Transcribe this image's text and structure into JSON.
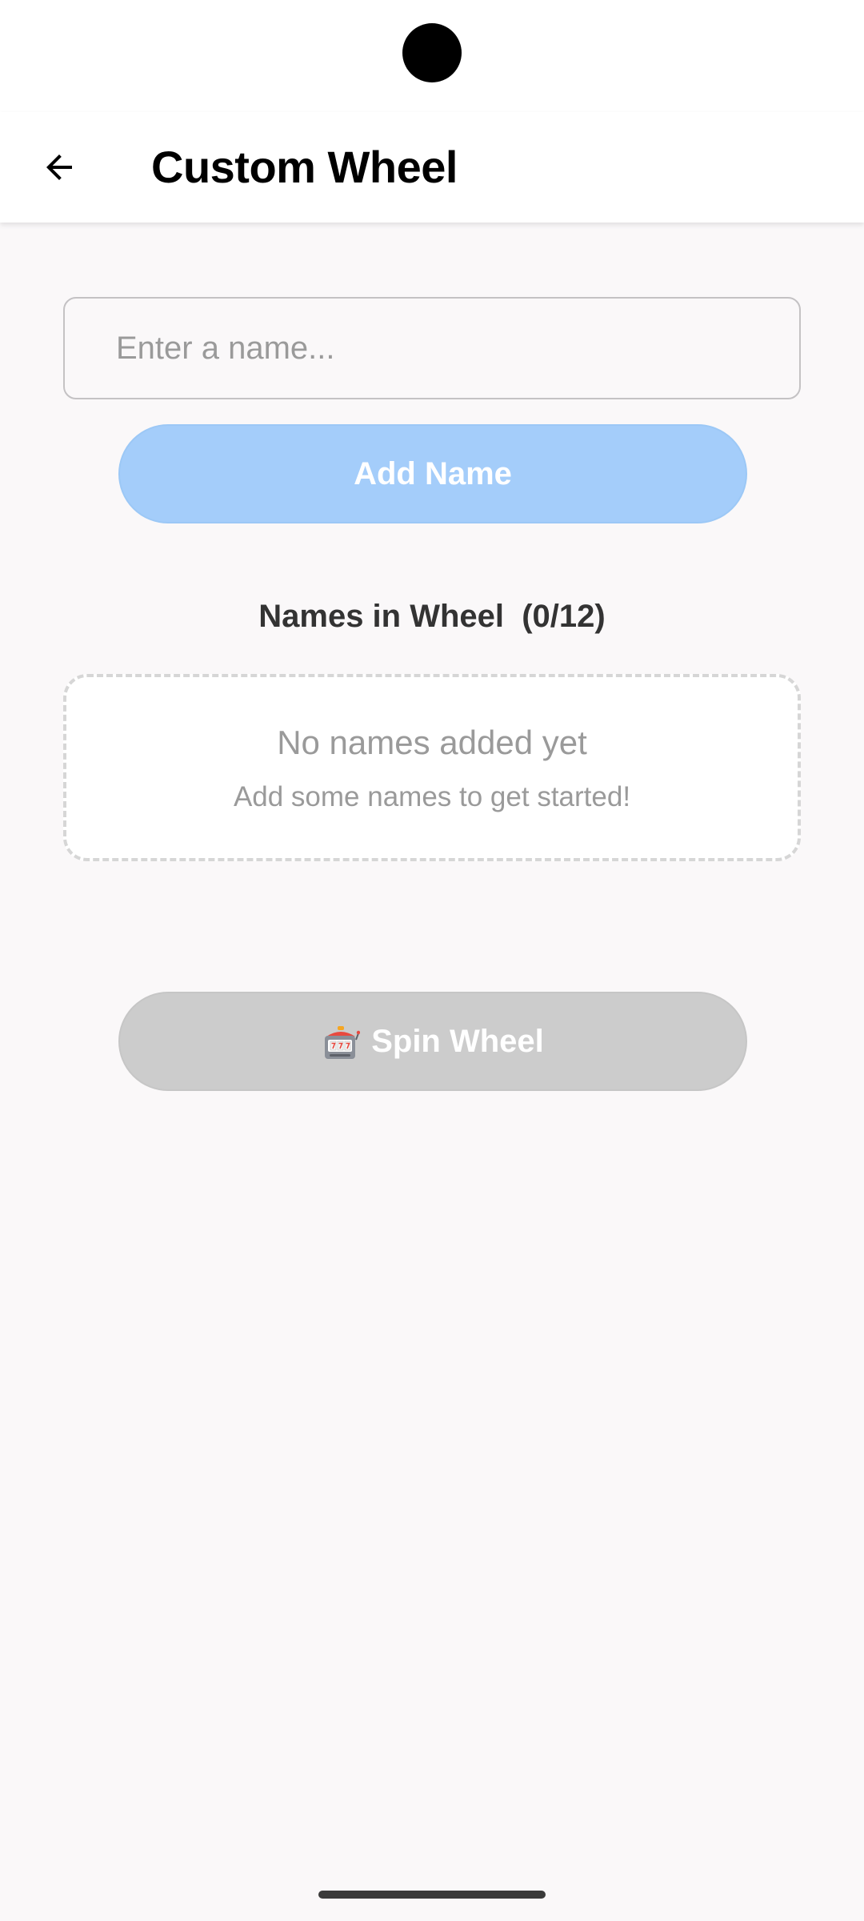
{
  "header": {
    "title": "Custom Wheel",
    "back_icon": "arrow-left-icon"
  },
  "form": {
    "name_value": "",
    "name_placeholder": "Enter a name...",
    "add_button_label": "Add Name"
  },
  "names": {
    "heading": "Names in Wheel  (0/12)",
    "items": [],
    "empty_title": "No names added yet",
    "empty_subtitle": "Add some names to get started!"
  },
  "spin": {
    "icon": "slot-machine-icon",
    "label": "Spin Wheel"
  },
  "colors": {
    "add_button_bg": "#a4cdfa",
    "spin_button_bg": "#cccccc",
    "content_bg": "#faf8f9"
  }
}
